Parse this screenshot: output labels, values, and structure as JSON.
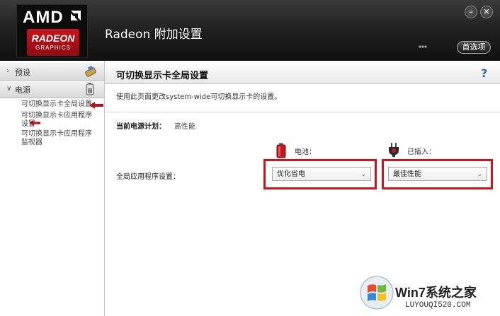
{
  "app": {
    "title": "Radeon 附加设置",
    "logo": {
      "brand": "AMD",
      "product": "RADEON",
      "tagline": "GRAPHICS"
    },
    "preferences_label": "首选项",
    "minimize_glyph": "–",
    "close_glyph": "✕"
  },
  "sidebar": {
    "categories": [
      {
        "arrow": "›",
        "label": "预设",
        "icon": "presets-icon"
      },
      {
        "arrow": "∨",
        "label": "电源",
        "icon": "battery-icon"
      }
    ],
    "items": [
      {
        "label": "可切换显示卡全局设置",
        "selected": true
      },
      {
        "label": "可切换显示卡应用程序设置"
      },
      {
        "label": "可切换显示卡应用程序监视器"
      }
    ]
  },
  "main": {
    "title": "可切换显示卡全局设置",
    "help": "?",
    "description": "使用此页面更改system-wide可切换显示卡的设置。",
    "power_plan_label": "当前电源计划：",
    "power_plan_value": "高性能",
    "battery_label": "电池：",
    "plugged_label": "已插入：",
    "global_setting_label": "全局应用程序设置：",
    "battery_option": "优化省电",
    "plugged_option": "最佳性能"
  },
  "colors": {
    "highlight": "#d0141a",
    "amd_red": "#c8141c"
  }
}
